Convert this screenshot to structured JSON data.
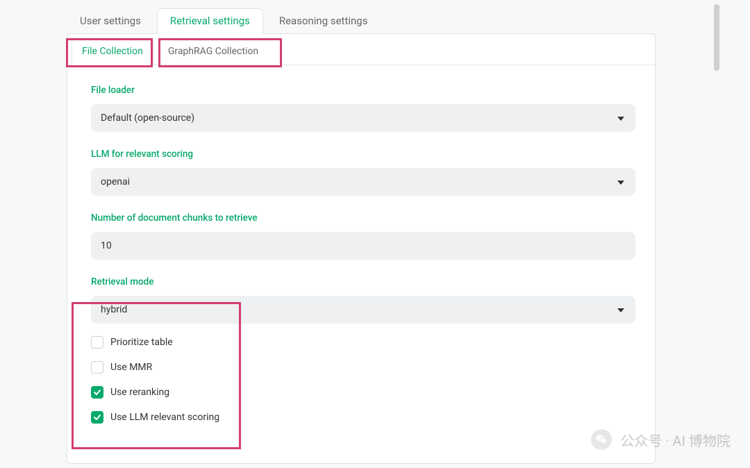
{
  "top_tabs": {
    "user": "User settings",
    "retrieval": "Retrieval settings",
    "reasoning": "Reasoning settings",
    "active": "retrieval"
  },
  "sub_tabs": {
    "file": "File Collection",
    "graph": "GraphRAG Collection",
    "active": "file"
  },
  "fields": {
    "file_loader": {
      "label": "File loader",
      "value": "Default (open-source)"
    },
    "llm_scoring": {
      "label": "LLM for relevant scoring",
      "value": "openai"
    },
    "num_chunks": {
      "label": "Number of document chunks to retrieve",
      "value": "10"
    },
    "retrieval_mode": {
      "label": "Retrieval mode",
      "value": "hybrid"
    }
  },
  "checkboxes": {
    "prioritize_table": {
      "label": "Prioritize table",
      "checked": false
    },
    "use_mmr": {
      "label": "Use MMR",
      "checked": false
    },
    "use_reranking": {
      "label": "Use reranking",
      "checked": true
    },
    "use_llm_scoring": {
      "label": "Use LLM relevant scoring",
      "checked": true
    }
  },
  "watermark": "公众号 · AI 博物院"
}
